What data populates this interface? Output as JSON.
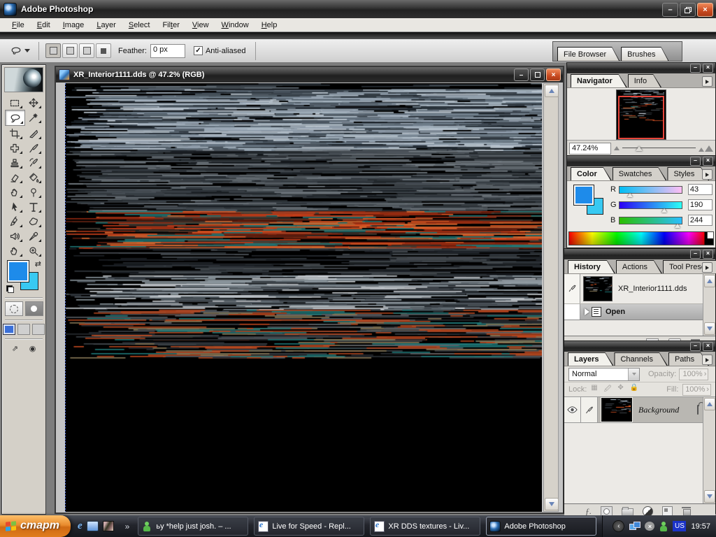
{
  "app": {
    "title": "Adobe Photoshop"
  },
  "menu": {
    "items": [
      "File",
      "Edit",
      "Image",
      "Layer",
      "Select",
      "Filter",
      "View",
      "Window",
      "Help"
    ],
    "accel_index": [
      0,
      0,
      0,
      0,
      0,
      3,
      0,
      0,
      0
    ]
  },
  "options": {
    "feather_label": "Feather:",
    "feather_value": "0 px",
    "antialiased_label": "Anti-aliased",
    "check_glyph": "✓",
    "well_tabs": [
      "File Browser",
      "Brushes"
    ]
  },
  "toolbox": {
    "tools": [
      "Rectangular Marquee",
      "Move",
      "Lasso",
      "Magic Wand",
      "Crop",
      "Slice",
      "Healing Brush",
      "Brush",
      "Clone Stamp",
      "History Brush",
      "Eraser",
      "Paint Bucket",
      "Smudge",
      "Dodge",
      "Path Selection",
      "Type",
      "Pen",
      "Custom Shape",
      "Notes",
      "Eyedropper",
      "Hand",
      "Zoom"
    ],
    "selected_tool": "Lasso",
    "foreground_color": "#1e8bea",
    "background_color": "#38c9f2"
  },
  "document": {
    "title": "XR_Interior1111.dds @ 47.2% (RGB)"
  },
  "navigator": {
    "tabs": [
      "Navigator",
      "Info"
    ],
    "active_tab": "Navigator",
    "zoom_value": "47.24%"
  },
  "color": {
    "tabs": [
      "Color",
      "Swatches",
      "Styles"
    ],
    "active_tab": "Color",
    "channels": [
      {
        "label": "R",
        "value": "43",
        "pos": 17
      },
      {
        "label": "G",
        "value": "190",
        "pos": 72
      },
      {
        "label": "B",
        "value": "244",
        "pos": 93
      }
    ]
  },
  "history": {
    "tabs": [
      "History",
      "Actions",
      "Tool Presets"
    ],
    "active_tab": "History",
    "snapshot_label": "XR_Interior1111.dds",
    "state_label": "Open"
  },
  "layers": {
    "tabs": [
      "Layers",
      "Channels",
      "Paths"
    ],
    "active_tab": "Layers",
    "blend_mode": "Normal",
    "opacity_label": "Opacity:",
    "opacity_value": "100%",
    "lock_label": "Lock:",
    "fill_label": "Fill:",
    "fill_value": "100%",
    "layer_name": "Background"
  },
  "taskbar": {
    "start_label": "старт",
    "quick_launch": [
      "internet-explorer",
      "outlook-express",
      "photo"
    ],
    "overflow_glyph": "»",
    "buttons": [
      "ьу *help  just josh. – ...",
      "Live for Speed - Repl...",
      "XR DDS textures - Liv...",
      "Adobe Photoshop"
    ],
    "active_button": "Adobe Photoshop",
    "tray": {
      "language": "US",
      "time": "19:57"
    }
  },
  "texture": {
    "description": "corrupted DDS texture, horizontal glitch stripes on black",
    "bands": [
      {
        "from": 0.0,
        "to": 0.015,
        "density": 6,
        "colors": [
          "#4a545c",
          "#2a3138",
          "#6b7680"
        ]
      },
      {
        "from": 0.015,
        "to": 0.155,
        "density": 26,
        "colors": [
          "#9aa8b6",
          "#c4cfd9",
          "#6e7d8a",
          "#3c4650",
          "#1e262e",
          "#aab8c4",
          "#57646f"
        ]
      },
      {
        "from": 0.155,
        "to": 0.3,
        "density": 16,
        "colors": [
          "#4a5158",
          "#2c3238",
          "#61696f",
          "#1a1f24",
          "#3b4248",
          "#747c83"
        ]
      },
      {
        "from": 0.3,
        "to": 0.385,
        "density": 18,
        "colors": [
          "#c23b18",
          "#e25722",
          "#932910",
          "#611d0e",
          "#302b26",
          "#484138",
          "#d86a30",
          "#1f7a7a"
        ]
      },
      {
        "from": 0.385,
        "to": 0.45,
        "density": 9,
        "colors": [
          "#343a40",
          "#24292e",
          "#4b5157",
          "#1c2126"
        ]
      },
      {
        "from": 0.45,
        "to": 0.53,
        "density": 15,
        "colors": [
          "#8e98a0",
          "#cbd0d5",
          "#576068",
          "#2b3137"
        ]
      },
      {
        "from": 0.53,
        "to": 0.64,
        "density": 11,
        "colors": [
          "#3e444a",
          "#282d32",
          "#b2461e",
          "#8b7b59",
          "#5b6167",
          "#c24a20",
          "#1f7a7a"
        ]
      },
      {
        "from": 0.64,
        "to": 1.0,
        "density": 0,
        "colors": []
      }
    ]
  }
}
